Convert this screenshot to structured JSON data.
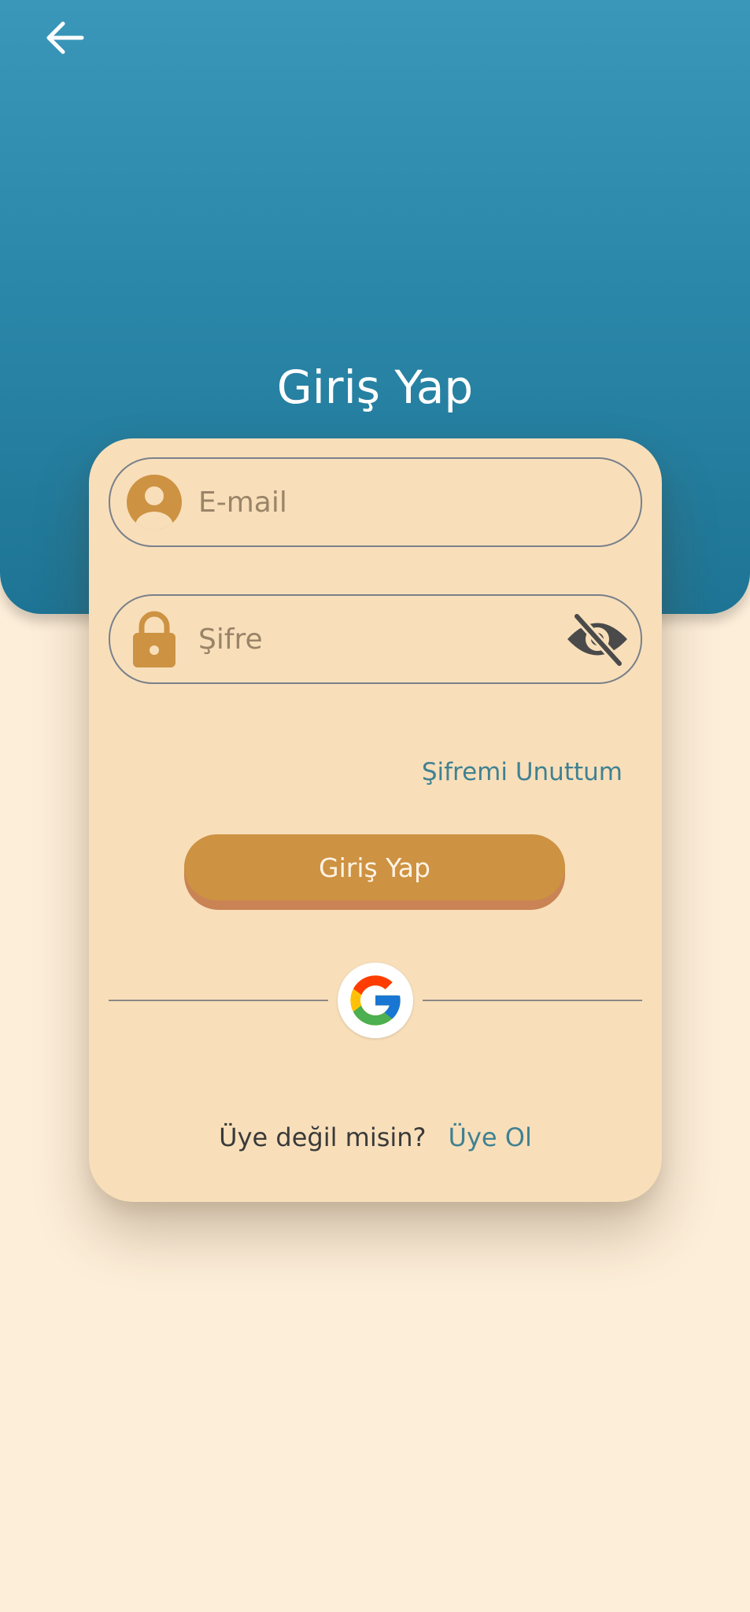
{
  "header": {
    "title": "Giriş Yap"
  },
  "form": {
    "email_placeholder": "E-mail",
    "password_placeholder": "Şifre",
    "forgot_password": "Şifremi Unuttum",
    "login_button": "Giriş Yap"
  },
  "footer": {
    "question": "Üye değil misin?",
    "signup_link": "Üye Ol"
  },
  "icons": {
    "back": "back-arrow-icon",
    "email": "user-avatar-icon",
    "password": "padlock-icon",
    "visibility": "eye-slash-icon",
    "social": "google-icon"
  },
  "colors": {
    "header_top": "#3a97ba",
    "header_bottom": "#1e7494",
    "page_background": "#fdeed9",
    "card_background": "#f8dfba",
    "accent": "#cd9242",
    "link": "#3f8192"
  }
}
